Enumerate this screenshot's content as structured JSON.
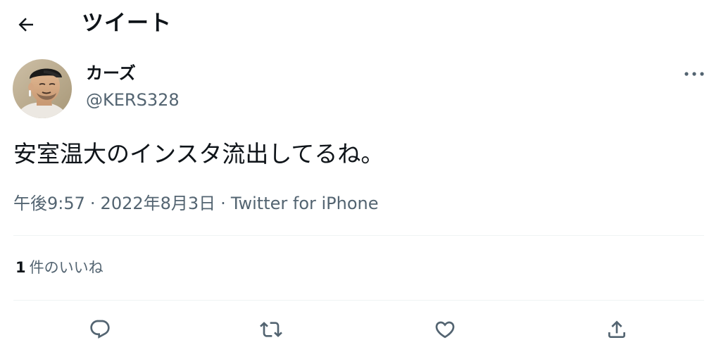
{
  "header": {
    "back_icon": "arrow-left-icon",
    "title": "ツイート"
  },
  "tweet": {
    "author": {
      "display_name": "カーズ",
      "username": "@KERS328",
      "avatar_icon": "user-avatar"
    },
    "more_icon": "more-horizontal-icon",
    "text": "安室温大のインスタ流出してるね。",
    "time": "午後9:57",
    "separator": "·",
    "date": "2022年8月3日",
    "source": "Twitter for iPhone"
  },
  "stats": {
    "likes_count": "1",
    "likes_label": "件のいいね"
  },
  "actions": [
    {
      "name": "reply",
      "icon": "reply-icon"
    },
    {
      "name": "retweet",
      "icon": "retweet-icon"
    },
    {
      "name": "like",
      "icon": "heart-icon"
    },
    {
      "name": "share",
      "icon": "share-icon"
    }
  ],
  "colors": {
    "text_primary": "#0f1419",
    "text_secondary": "#536471",
    "divider": "#eff3f4",
    "background": "#ffffff"
  }
}
